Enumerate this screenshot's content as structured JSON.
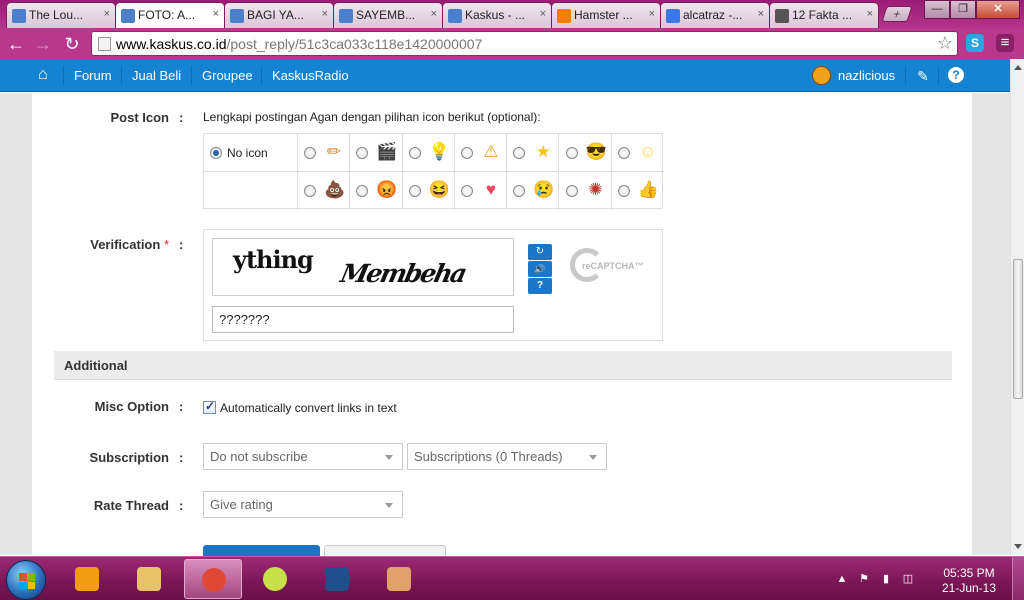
{
  "browser": {
    "tabs": [
      {
        "title": "The Lou...",
        "favicon_color": "#4a7fcc"
      },
      {
        "title": "FOTO: A...",
        "favicon_color": "#4a7fcc"
      },
      {
        "title": "BAGI YA...",
        "favicon_color": "#4a7fcc"
      },
      {
        "title": "SAYEMB...",
        "favicon_color": "#4a7fcc"
      },
      {
        "title": "Kaskus - ...",
        "favicon_color": "#4a7fcc"
      },
      {
        "title": "Hamster ...",
        "favicon_color": "#f57d00"
      },
      {
        "title": "alcatraz -...",
        "favicon_color": "#3b78e7"
      },
      {
        "title": "12 Fakta ...",
        "favicon_color": "#555555"
      }
    ],
    "active_tab_index": 1,
    "tab_close_glyph": "×",
    "new_tab_glyph": "+",
    "window_buttons": {
      "minimize": "—",
      "maximize": "❐",
      "close": "✕"
    },
    "url_host": "www.kaskus.co.id",
    "url_path": "/post_reply/51c3ca033c118e1420000007",
    "nav_glyphs": {
      "back": "←",
      "forward": "→",
      "reload": "↻",
      "star": "☆",
      "wrench": "≡"
    },
    "extensions": [
      {
        "name": "skype-icon",
        "glyph": "S",
        "color": "#2aa5e3"
      },
      {
        "name": "menu-icon",
        "glyph": "≡",
        "color": "#b8388c"
      }
    ]
  },
  "kaskus_nav": {
    "home_glyph": "⌂",
    "links": [
      "Forum",
      "Jual Beli",
      "Groupee",
      "KaskusRadio"
    ],
    "username": "nazlicious",
    "edit_glyph": "✎",
    "help_glyph": "?"
  },
  "form": {
    "post_icon": {
      "label": "Post Icon",
      "colon": ":",
      "hint": "Lengkapi postingan Agan dengan pilihan icon berikut (optional):",
      "no_icon_label": "No icon",
      "row1_icons": [
        {
          "name": "pencil-icon",
          "glyph": "✏",
          "color": "#d9822b"
        },
        {
          "name": "clapperboard-icon",
          "glyph": "🎬",
          "color": "#222222"
        },
        {
          "name": "lightbulb-icon",
          "glyph": "💡",
          "color": "#f0c419"
        },
        {
          "name": "warning-icon",
          "glyph": "⚠",
          "color": "#e8a21b"
        },
        {
          "name": "star-icon",
          "glyph": "★",
          "color": "#f7c325"
        },
        {
          "name": "cool-face-icon",
          "glyph": "😎",
          "color": "#3aa0e0"
        },
        {
          "name": "smile-face-icon",
          "glyph": "☺",
          "color": "#f5d430"
        }
      ],
      "row2_icons": [
        {
          "name": "poop-icon",
          "glyph": "💩",
          "color": "#b57a3a"
        },
        {
          "name": "angry-face-icon",
          "glyph": "😡",
          "color": "#d9331f"
        },
        {
          "name": "laugh-face-icon",
          "glyph": "😆",
          "color": "#f06f2a"
        },
        {
          "name": "heart-icon",
          "glyph": "♥",
          "color": "#e8475d"
        },
        {
          "name": "crying-face-icon",
          "glyph": "😢",
          "color": "#4fb6e6"
        },
        {
          "name": "spiky-face-icon",
          "glyph": "✺",
          "color": "#c0392b"
        },
        {
          "name": "thumbs-up-icon",
          "glyph": "👍",
          "color": "#f0b030"
        }
      ]
    },
    "verification": {
      "label": "Verification",
      "required_mark": "*",
      "colon": ":",
      "captcha_word1": "ything",
      "captcha_word2": "Membeha",
      "input_value": "???????",
      "refresh_glyph": "↻",
      "audio_glyph": "🔊",
      "help_glyph": "?",
      "recaptcha_logo": "reCAPTCHA™"
    },
    "additional": {
      "title": "Additional",
      "misc_option": {
        "label": "Misc Option",
        "colon": ":",
        "checkbox_label": "Automatically convert links in text",
        "checked": true
      },
      "subscription": {
        "label": "Subscription",
        "colon": ":",
        "select1": "Do not subscribe",
        "select2": "Subscriptions (0 Threads)"
      },
      "rate_thread": {
        "label": "Rate Thread",
        "colon": ":",
        "select": "Give rating"
      }
    }
  },
  "taskbar": {
    "apps": [
      {
        "name": "media-player-icon",
        "color": "#f39c12"
      },
      {
        "name": "file-explorer-icon",
        "color": "#e8c26a"
      },
      {
        "name": "chrome-icon",
        "color": "#e04836"
      },
      {
        "name": "chrome-alt-icon",
        "color": "#c7e04a"
      },
      {
        "name": "photoshop-icon",
        "color": "#1f4e8a"
      },
      {
        "name": "paint-icon",
        "color": "#e0a06a"
      }
    ],
    "active_app_index": 2,
    "tray_glyphs": [
      "▲",
      "⚑",
      "▮",
      "◫"
    ],
    "time": "05:35 PM",
    "date": "21-Jun-13"
  }
}
